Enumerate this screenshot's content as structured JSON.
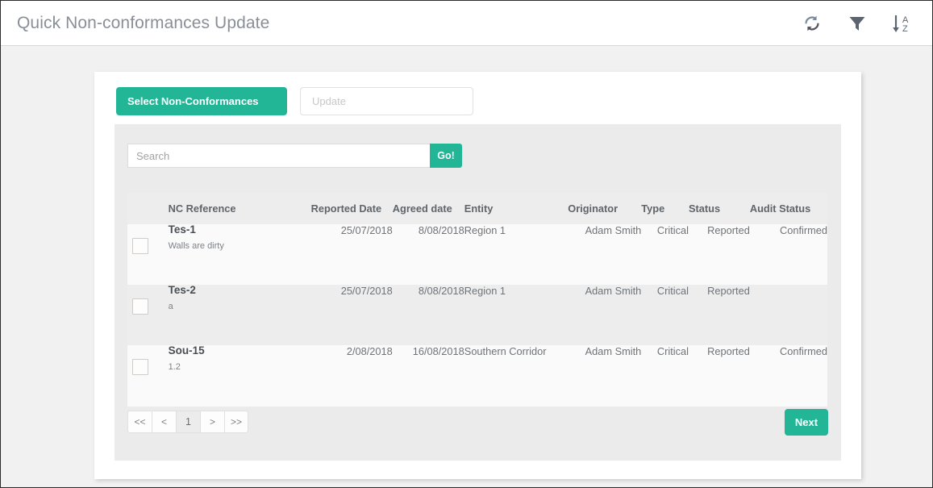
{
  "header": {
    "title": "Quick Non-conformances Update",
    "actions": [
      {
        "name": "refresh-icon",
        "label": "Refresh"
      },
      {
        "name": "filter-icon",
        "label": "Filter"
      },
      {
        "name": "sort-az-icon",
        "label": "Sort A-Z"
      }
    ]
  },
  "tabs": [
    {
      "label": "Select Non-Conformances",
      "active": true
    },
    {
      "label": "Update",
      "active": false
    }
  ],
  "search": {
    "value": "",
    "placeholder": "Search",
    "button_label": "Go!"
  },
  "table": {
    "columns": [
      "NC Reference",
      "Reported Date",
      "Agreed date",
      "Entity",
      "Originator",
      "Type",
      "Status",
      "Audit Status"
    ],
    "rows": [
      {
        "reference": "Tes-1",
        "description": "Walls are dirty",
        "reported_date": "25/07/2018",
        "agreed_date": "8/08/2018",
        "entity": "Region 1",
        "originator": "Adam Smith",
        "type": "Critical",
        "status": "Reported",
        "audit_status": "Confirmed",
        "selected": false
      },
      {
        "reference": "Tes-2",
        "description": "a",
        "reported_date": "25/07/2018",
        "agreed_date": "8/08/2018",
        "entity": "Region 1",
        "originator": "Adam Smith",
        "type": "Critical",
        "status": "Reported",
        "audit_status": "",
        "selected": false
      },
      {
        "reference": "Sou-15",
        "description": "1.2",
        "reported_date": "2/08/2018",
        "agreed_date": "16/08/2018",
        "entity": "Southern Corridor",
        "originator": "Adam Smith",
        "type": "Critical",
        "status": "Reported",
        "audit_status": "Confirmed",
        "selected": false
      }
    ]
  },
  "pagination": {
    "first_label": "<<",
    "prev_label": "<",
    "current_page": "1",
    "next_label": ">",
    "last_label": ">>"
  },
  "footer": {
    "next_button_label": "Next"
  },
  "colors": {
    "accent_green": "#22b596",
    "title_gray": "#898f96",
    "panel_gray": "#ebebeb",
    "icon_gray": "#5b6470"
  }
}
